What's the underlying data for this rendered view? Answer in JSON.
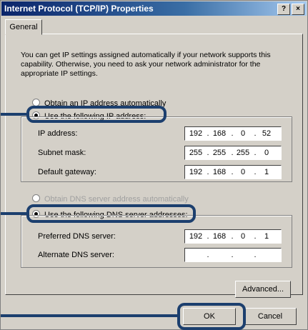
{
  "window": {
    "title": "Internet Protocol (TCP/IP) Properties",
    "help_glyph": "?",
    "close_glyph": "×"
  },
  "tabs": [
    {
      "label": "General"
    }
  ],
  "description": "You can get IP settings assigned automatically if your network supports this capability. Otherwise, you need to ask your network administrator for the appropriate IP settings.",
  "ip_section": {
    "auto_radio": "Obtain an IP address automatically",
    "manual_radio": "Use the following IP address:",
    "fields": [
      {
        "label": "IP address:",
        "octets": [
          "192",
          "168",
          "0",
          "52"
        ]
      },
      {
        "label": "Subnet mask:",
        "octets": [
          "255",
          "255",
          "255",
          "0"
        ]
      },
      {
        "label": "Default gateway:",
        "octets": [
          "192",
          "168",
          "0",
          "1"
        ]
      }
    ]
  },
  "dns_section": {
    "auto_radio": "Obtain DNS server address automatically",
    "manual_radio": "Use the following DNS server addresses:",
    "fields": [
      {
        "label": "Preferred DNS server:",
        "octets": [
          "192",
          "168",
          "0",
          "1"
        ]
      },
      {
        "label": "Alternate DNS server:",
        "octets": [
          "",
          "",
          "",
          ""
        ]
      }
    ]
  },
  "buttons": {
    "advanced": "Advanced...",
    "ok": "OK",
    "cancel": "Cancel"
  },
  "highlight_color": "#1c3f6e"
}
